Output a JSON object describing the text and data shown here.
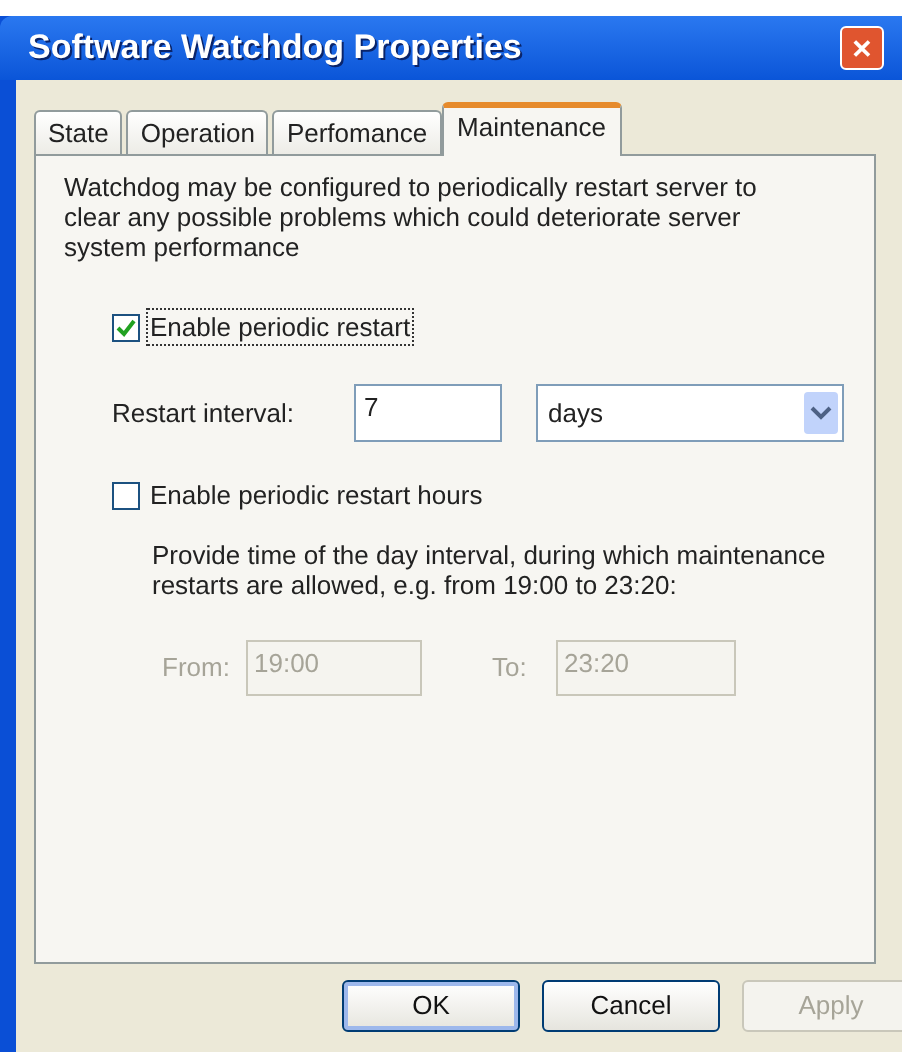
{
  "window": {
    "title": "Software Watchdog Properties",
    "close": "✕"
  },
  "tabs": [
    {
      "label": "State",
      "selected": false
    },
    {
      "label": "Operation",
      "selected": false
    },
    {
      "label": "Perfomance",
      "selected": false
    },
    {
      "label": "Maintenance",
      "selected": true
    }
  ],
  "description": "Watchdog may be configured to periodically restart server to clear any possible problems which could deteriorate server system performance",
  "periodic_restart": {
    "label": "Enable periodic restart",
    "checked": true,
    "focused": true
  },
  "restart_interval": {
    "label": "Restart interval:",
    "value": "7",
    "unit": "days"
  },
  "restart_hours": {
    "label": "Enable periodic restart hours",
    "checked": false,
    "focused": false,
    "help": "Provide time of the day interval, during which maintenance restarts are allowed, e.g. from 19:00 to 23:20:",
    "from": {
      "label": "From:",
      "value": "19:00",
      "disabled": true
    },
    "to": {
      "label": "To:",
      "value": "23:20",
      "disabled": true
    }
  },
  "buttons": [
    {
      "label": "OK",
      "disabled": false,
      "default": true
    },
    {
      "label": "Cancel",
      "disabled": false,
      "default": false
    },
    {
      "label": "Apply",
      "disabled": true,
      "default": false
    }
  ]
}
